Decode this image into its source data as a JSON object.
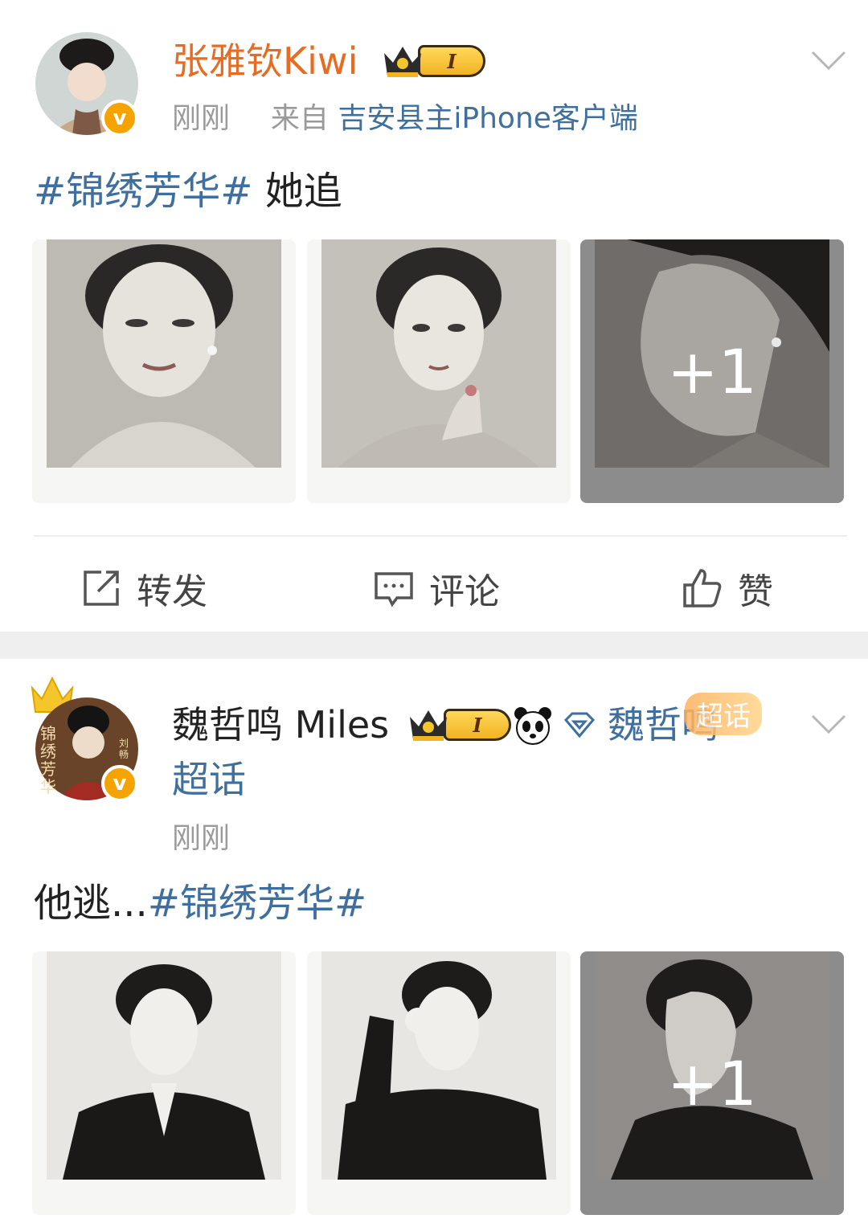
{
  "post1": {
    "username": "张雅钦Kiwi",
    "level_badge": "I",
    "time": "刚刚",
    "source_prefix": "来自",
    "source": "吉安县主iPhone客户端",
    "text": {
      "hashtag": "#锦绣芳华#",
      "body": "她追"
    },
    "more_count": "+1"
  },
  "actions": {
    "repost": "转发",
    "comment": "评论",
    "like": "赞"
  },
  "post2": {
    "username": "魏哲鸣 Miles",
    "level_badge": "I",
    "super_topic_link": "魏哲鸣",
    "super_topic_link_line2": "超话",
    "super_topic_badge": "超话",
    "avatar_text_left": "锦绣芳华",
    "avatar_text_right": "刘畅",
    "time": "刚刚",
    "text": {
      "body": "他逃...",
      "hashtag": "#锦绣芳华#"
    },
    "more_count": "+1"
  },
  "colors": {
    "username_highlight": "#e86b22",
    "link_blue": "#3f6f9e",
    "meta_grey": "#9a9a9a",
    "verified_badge": "#f4a300"
  },
  "icons": [
    "chevron-down-icon",
    "verified-v-icon",
    "crown-icon",
    "repost-icon",
    "comment-icon",
    "like-icon",
    "panda-icon",
    "diamond-icon"
  ]
}
